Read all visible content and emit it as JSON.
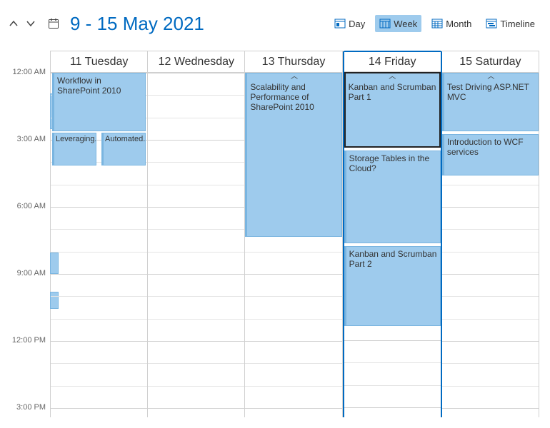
{
  "date_range_title": "9  - 15 May 2021",
  "views": {
    "day": "Day",
    "week": "Week",
    "month": "Month",
    "timeline": "Timeline"
  },
  "time_labels": [
    "12:00 AM",
    "3:00 AM",
    "6:00 AM",
    "9:00 AM",
    "12:00 PM",
    "3:00 PM"
  ],
  "days": [
    {
      "label": "11 Tuesday"
    },
    {
      "label": "12 Wednesday"
    },
    {
      "label": "13 Thursday"
    },
    {
      "label": "14 Friday"
    },
    {
      "label": "15 Saturday"
    }
  ],
  "events": {
    "tue_workflow": "Workflow in SharePoint 2010",
    "tue_leveraging": "Leveraging...",
    "tue_automated": "Automated...",
    "thu_scalability": "Scalability and Performance of SharePoint 2010",
    "fri_kanban1": "Kanban and Scrumban Part 1",
    "fri_storage": "Storage Tables in the Cloud?",
    "fri_kanban2": "Kanban and Scrumban Part 2",
    "sat_test": "Test Driving ASP.NET MVC",
    "sat_wcf": "Introduction to WCF services"
  }
}
